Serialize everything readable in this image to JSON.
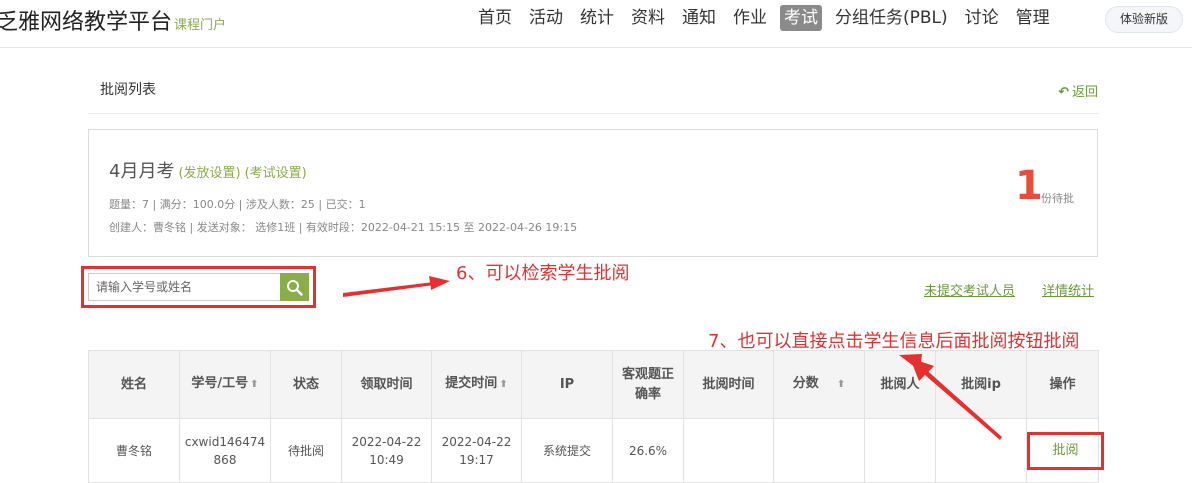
{
  "brand": {
    "name": "乏雅网络教学平台",
    "sub": "课程门户"
  },
  "nav": {
    "items": [
      {
        "label": "首页",
        "active": false
      },
      {
        "label": "活动",
        "active": false
      },
      {
        "label": "统计",
        "active": false
      },
      {
        "label": "资料",
        "active": false
      },
      {
        "label": "通知",
        "active": false
      },
      {
        "label": "作业",
        "active": false
      },
      {
        "label": "考试",
        "active": true
      },
      {
        "label": "分组任务(PBL)",
        "active": false
      },
      {
        "label": "讨论",
        "active": false
      },
      {
        "label": "管理",
        "active": false
      }
    ],
    "new_version": "体验新版"
  },
  "list_header": {
    "title": "批阅列表",
    "back": "返回"
  },
  "exam": {
    "title": "4月月考",
    "release_settings": "(发放设置)",
    "exam_settings": "(考试设置)",
    "stats": "题量：7 |  满分：100.0分 |  涉及人数：25 | 已交：1",
    "info": "创建人：曹冬铭 | 发送对象：  选修1班  |  有效时段：2022-04-21 15:15 至 2022-04-26 19:15",
    "pending_count": "1",
    "pending_label": "份待批"
  },
  "search": {
    "placeholder": "请输入学号或姓名"
  },
  "links": {
    "unsubmitted": "未提交考试人员",
    "detail_stats": "详情统计"
  },
  "annotations": {
    "step6": "6、可以检索学生批阅",
    "step7": "7、也可以直接点击学生信息后面批阅按钮批阅"
  },
  "table": {
    "headers": {
      "name": "姓名",
      "id": "学号/工号",
      "status": "状态",
      "receive_time": "领取时间",
      "submit_time": "提交时间",
      "ip": "IP",
      "accuracy_line1": "客观题正",
      "accuracy_line2": "确率",
      "review_time": "批阅时间",
      "score": "分数",
      "reviewer": "批阅人",
      "review_ip": "批阅ip",
      "action": "操作"
    },
    "row": {
      "name": "曹冬铭",
      "id_line1": "cxwid146474",
      "id_line2": "868",
      "status": "待批阅",
      "receive_date": "2022-04-22",
      "receive_time": "10:49",
      "submit_date": "2022-04-22",
      "submit_time": "19:17",
      "ip": "系统提交",
      "accuracy": "26.6%",
      "review_time": "",
      "score": "",
      "reviewer": "",
      "review_ip": "",
      "action": "批阅"
    }
  },
  "colors": {
    "accent_green": "#8bac4a",
    "link_green": "#6a9a3a",
    "annotation_red": "#e53030",
    "pending_red": "#e74c3c"
  }
}
